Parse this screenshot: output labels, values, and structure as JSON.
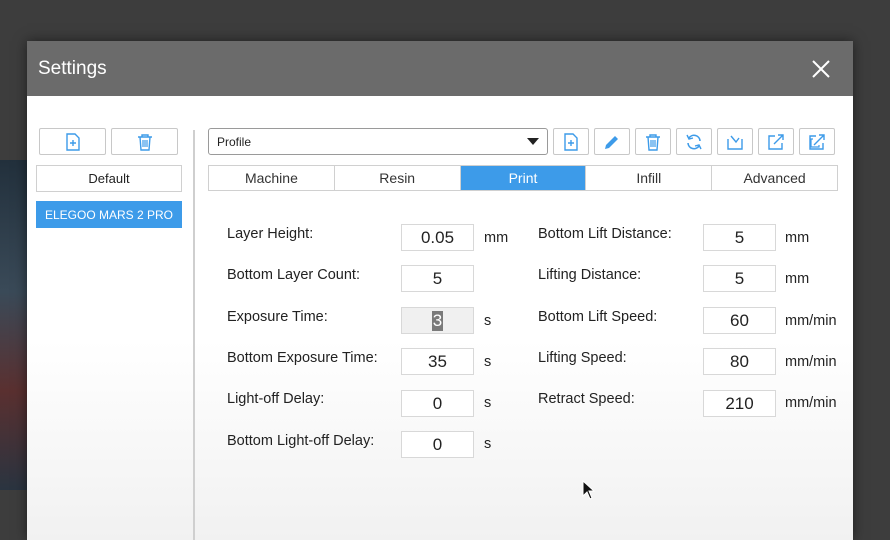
{
  "dialog": {
    "title": "Settings"
  },
  "sidebar": {
    "items": [
      {
        "label": "Default",
        "selected": false
      },
      {
        "label": "ELEGOO MARS 2 PRO",
        "selected": true
      }
    ]
  },
  "profile": {
    "selected": "Profile"
  },
  "toolbar": {
    "icons": [
      "new-file-icon",
      "edit-icon",
      "delete-icon",
      "refresh-icon",
      "import-icon",
      "export-icon",
      "export-all-icon"
    ]
  },
  "tabs": [
    {
      "label": "Machine",
      "active": false
    },
    {
      "label": "Resin",
      "active": false
    },
    {
      "label": "Print",
      "active": true
    },
    {
      "label": "Infill",
      "active": false
    },
    {
      "label": "Advanced",
      "active": false
    }
  ],
  "fields_left": [
    {
      "label": "Layer Height:",
      "value": "0.05",
      "unit": "mm"
    },
    {
      "label": "Bottom Layer Count:",
      "value": "5",
      "unit": ""
    },
    {
      "label": "Exposure Time:",
      "value": "3",
      "unit": "s"
    },
    {
      "label": "Bottom Exposure Time:",
      "value": "35",
      "unit": "s"
    },
    {
      "label": "Light-off Delay:",
      "value": "0",
      "unit": "s"
    },
    {
      "label": "Bottom Light-off Delay:",
      "value": "0",
      "unit": "s"
    }
  ],
  "fields_right": [
    {
      "label": "Bottom Lift Distance:",
      "value": "5",
      "unit": "mm"
    },
    {
      "label": "Lifting Distance:",
      "value": "5",
      "unit": "mm"
    },
    {
      "label": "Bottom Lift Speed:",
      "value": "60",
      "unit": "mm/min"
    },
    {
      "label": "Lifting Speed:",
      "value": "80",
      "unit": "mm/min"
    },
    {
      "label": "Retract Speed:",
      "value": "210",
      "unit": "mm/min"
    }
  ],
  "colors": {
    "accent": "#3d9be9",
    "header": "#6b6b6b"
  }
}
